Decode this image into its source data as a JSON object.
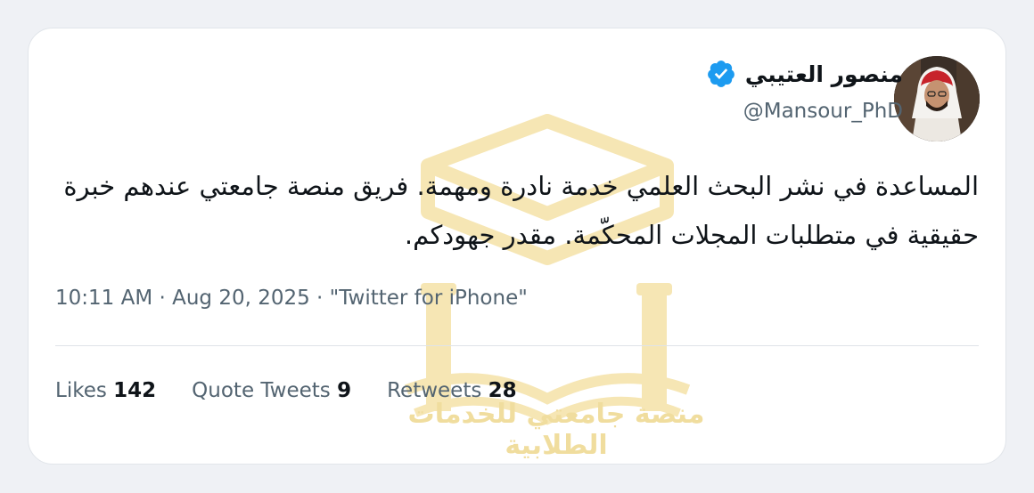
{
  "tweet": {
    "author": {
      "name": "منصور العتيبي",
      "handle": "@Mansour_PhD",
      "verified": true
    },
    "text": "المساعدة في نشر البحث العلمي خدمة نادرة ومهمة. فريق منصة جامعتي عندهم خبرة حقيقية في متطلبات المجلات المحكّمة. مقدر جهودكم.",
    "meta": "10:11 AM · Aug 20, 2025 · \"Twitter for iPhone\"",
    "stats": {
      "likes_label": "Likes",
      "likes_value": "142",
      "quotes_label": "Quote Tweets",
      "quotes_value": "9",
      "retweets_label": "Retweets",
      "retweets_value": "28"
    }
  },
  "watermark": {
    "text": "منصة جامعتي للخدمات الطلابية"
  },
  "colors": {
    "verified_badge": "#1d9bf0",
    "watermark": "#f0dd9e",
    "background": "#eff1f5"
  }
}
